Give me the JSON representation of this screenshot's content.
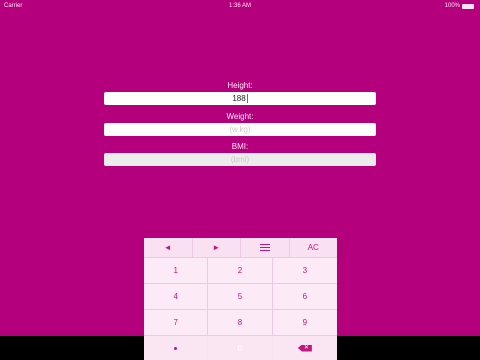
{
  "status_bar": {
    "carrier": "Carrier",
    "time": "1:36 AM",
    "battery_text": "100%",
    "battery_level": 1.0
  },
  "form": {
    "height_label": "Height:",
    "height_value": "188",
    "weight_label": "Weight:",
    "weight_placeholder": "(w.kg)",
    "bmi_label": "BMI:",
    "bmi_placeholder": "(bmi)"
  },
  "keyboard": {
    "top_row": {
      "left": "◄",
      "right": "►",
      "menu_icon": "hamburger-icon",
      "clear": "AC"
    },
    "keys": [
      "1",
      "2",
      "3",
      "4",
      "5",
      "6",
      "7",
      "8",
      "9"
    ],
    "bottom": {
      "dot_icon": "dot-icon",
      "zero": "0",
      "backspace_icon": "backspace-icon"
    }
  },
  "colors": {
    "background": "#b5007d",
    "key_text": "#c0187f",
    "keyboard_bg": "#fae6f3"
  }
}
